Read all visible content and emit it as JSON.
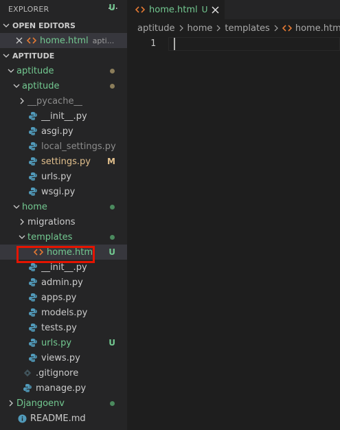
{
  "explorer": {
    "title": "EXPLORER",
    "more": "···",
    "open_editors": {
      "title": "OPEN EDITORS",
      "item": {
        "name": "home.html",
        "hint": "apti...",
        "badge": "U"
      }
    },
    "workspace": {
      "title": "APTITUDE"
    }
  },
  "tree": [
    {
      "label": "aptitude",
      "color": "green",
      "twist": "down",
      "icon": "",
      "badge": "",
      "dot": "#8b7d5a"
    },
    {
      "label": "aptitude",
      "color": "green",
      "twist": "down",
      "icon": "",
      "badge": "",
      "dot": "#8b7d5a"
    },
    {
      "label": "__pycache__",
      "color": "grey",
      "twist": "right",
      "icon": "",
      "badge": "",
      "dot": ""
    },
    {
      "label": "__init__.py",
      "color": "normal",
      "twist": "",
      "icon": "python",
      "badge": "",
      "dot": ""
    },
    {
      "label": "asgi.py",
      "color": "normal",
      "twist": "",
      "icon": "python",
      "badge": "",
      "dot": ""
    },
    {
      "label": "local_settings.py",
      "color": "grey",
      "twist": "",
      "icon": "python",
      "badge": "",
      "dot": ""
    },
    {
      "label": "settings.py",
      "color": "yellow",
      "twist": "",
      "icon": "python",
      "badge": "M",
      "dot": ""
    },
    {
      "label": "urls.py",
      "color": "normal",
      "twist": "",
      "icon": "python",
      "badge": "",
      "dot": ""
    },
    {
      "label": "wsgi.py",
      "color": "normal",
      "twist": "",
      "icon": "python",
      "badge": "",
      "dot": ""
    },
    {
      "label": "home",
      "color": "green",
      "twist": "down",
      "icon": "",
      "badge": "",
      "dot": "#4b8a5e"
    },
    {
      "label": "migrations",
      "color": "normal",
      "twist": "right",
      "icon": "",
      "badge": "",
      "dot": ""
    },
    {
      "label": "templates",
      "color": "green",
      "twist": "down",
      "icon": "",
      "badge": "",
      "dot": "#4b8a5e"
    },
    {
      "label": "home.html",
      "color": "green",
      "twist": "",
      "icon": "html",
      "badge": "U",
      "dot": ""
    },
    {
      "label": "__init__.py",
      "color": "normal",
      "twist": "",
      "icon": "python",
      "badge": "",
      "dot": ""
    },
    {
      "label": "admin.py",
      "color": "normal",
      "twist": "",
      "icon": "python",
      "badge": "",
      "dot": ""
    },
    {
      "label": "apps.py",
      "color": "normal",
      "twist": "",
      "icon": "python",
      "badge": "",
      "dot": ""
    },
    {
      "label": "models.py",
      "color": "normal",
      "twist": "",
      "icon": "python",
      "badge": "",
      "dot": ""
    },
    {
      "label": "tests.py",
      "color": "normal",
      "twist": "",
      "icon": "python",
      "badge": "",
      "dot": ""
    },
    {
      "label": "urls.py",
      "color": "green",
      "twist": "",
      "icon": "python",
      "badge": "U",
      "dot": ""
    },
    {
      "label": "views.py",
      "color": "normal",
      "twist": "",
      "icon": "python",
      "badge": "",
      "dot": ""
    },
    {
      "label": ".gitignore",
      "color": "normal",
      "twist": "",
      "icon": "git",
      "badge": "",
      "dot": ""
    },
    {
      "label": "manage.py",
      "color": "normal",
      "twist": "",
      "icon": "python",
      "badge": "",
      "dot": ""
    },
    {
      "label": "Djangoenv",
      "color": "green",
      "twist": "right",
      "icon": "",
      "badge": "",
      "dot": "#4b8a5e"
    },
    {
      "label": "README.md",
      "color": "normal",
      "twist": "",
      "icon": "info",
      "badge": "",
      "dot": ""
    }
  ],
  "editor": {
    "tab": {
      "name": "home.html",
      "badge": "U"
    },
    "breadcrumbs": [
      "aptitude",
      "home",
      "templates",
      "home.html"
    ],
    "line_number": "1"
  },
  "colors": {
    "green": "#73c991",
    "yellow": "#e2c08d",
    "grey": "#8c8c8c",
    "normal": "#cccccc",
    "python": "#519aba",
    "html": "#e37933",
    "highlight_box": "#e51400"
  }
}
